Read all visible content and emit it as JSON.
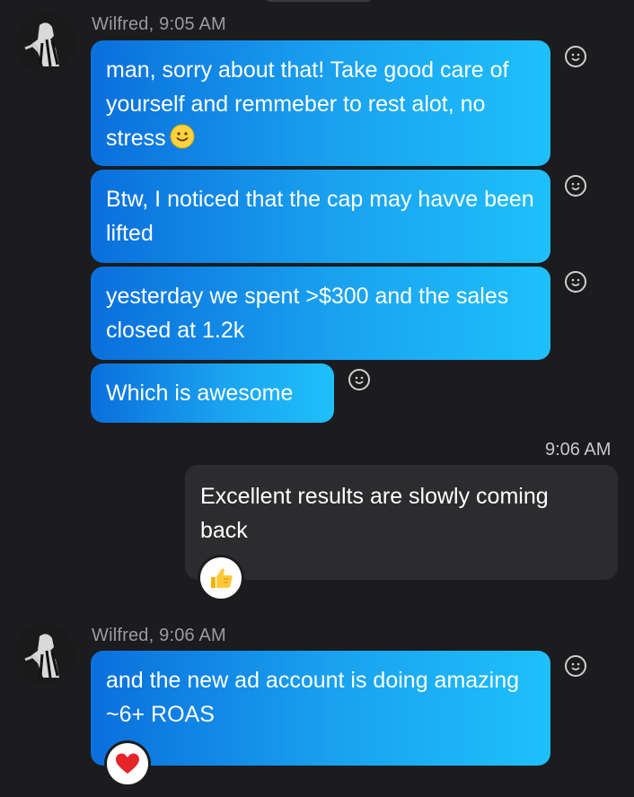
{
  "conversation": {
    "group1": {
      "sender": "Wilfred, 9:05 AM",
      "messages": [
        {
          "text": "man, sorry about that! Take good care of yourself and remmeber to rest alot, no stress",
          "emoji": "slightly-smiling-face-icon"
        },
        {
          "text": "Btw, I noticed that the cap may havve been lifted"
        },
        {
          "text": "yesterday we spent >$300 and the sales closed at 1.2k"
        },
        {
          "text": "Which is awesome"
        }
      ]
    },
    "outgoing": {
      "timestamp": "9:06 AM",
      "text": "Excellent results are slowly coming back",
      "reaction": "thumbs-up-icon"
    },
    "group2": {
      "sender": "Wilfred, 9:06 AM",
      "messages": [
        {
          "text": "and the new ad account is doing amazing ~6+ ROAS",
          "reaction": "heart-icon"
        }
      ]
    }
  },
  "colors": {
    "background": "#1c1c1e",
    "incoming_gradient_start": "#0a6fdc",
    "incoming_gradient_end": "#1ec0fb",
    "outgoing_bubble": "#2c2c2e",
    "heart": "#e5252a"
  }
}
